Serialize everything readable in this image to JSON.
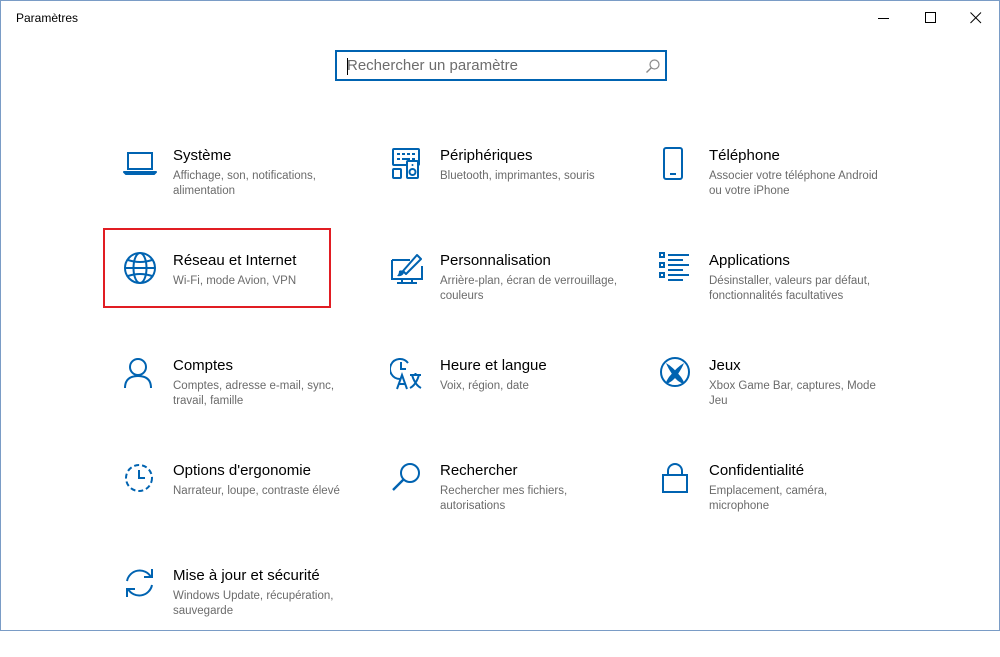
{
  "window": {
    "title": "Paramètres",
    "controls": [
      "minimize-icon",
      "maximize-icon",
      "close-icon"
    ]
  },
  "search": {
    "placeholder": "Rechercher un paramètre",
    "value": "",
    "icon": "search-icon"
  },
  "accent_color": "#0063b1",
  "highlight_color": "#e11d23",
  "highlighted_item": "Réseau et Internet",
  "categories": [
    {
      "name": "Système",
      "description": "Affichage, son, notifications, alimentation",
      "icon": "laptop-icon"
    },
    {
      "name": "Périphériques",
      "description": "Bluetooth, imprimantes, souris",
      "icon": "devices-icon"
    },
    {
      "name": "Téléphone",
      "description": "Associer votre téléphone Android ou votre iPhone",
      "icon": "phone-icon"
    },
    {
      "name": "Réseau et Internet",
      "description": "Wi-Fi, mode Avion, VPN",
      "icon": "globe-icon"
    },
    {
      "name": "Personnalisation",
      "description": "Arrière-plan, écran de verrouillage, couleurs",
      "icon": "paintbrush-icon"
    },
    {
      "name": "Applications",
      "description": "Désinstaller, valeurs par défaut, fonctionnalités facultatives",
      "icon": "apps-list-icon"
    },
    {
      "name": "Comptes",
      "description": "Comptes, adresse e-mail, sync, travail, famille",
      "icon": "person-icon"
    },
    {
      "name": "Heure et langue",
      "description": "Voix, région, date",
      "icon": "time-language-icon"
    },
    {
      "name": "Jeux",
      "description": "Xbox Game Bar, captures, Mode Jeu",
      "icon": "xbox-icon"
    },
    {
      "name": "Options d'ergonomie",
      "description": "Narrateur, loupe, contraste élevé",
      "icon": "ease-of-access-icon"
    },
    {
      "name": "Rechercher",
      "description": "Rechercher mes fichiers, autorisations",
      "icon": "magnifier-icon"
    },
    {
      "name": "Confidentialité",
      "description": "Emplacement, caméra, microphone",
      "icon": "lock-icon"
    },
    {
      "name": "Mise à jour et sécurité",
      "description": "Windows Update, récupération, sauvegarde",
      "icon": "update-icon"
    }
  ]
}
